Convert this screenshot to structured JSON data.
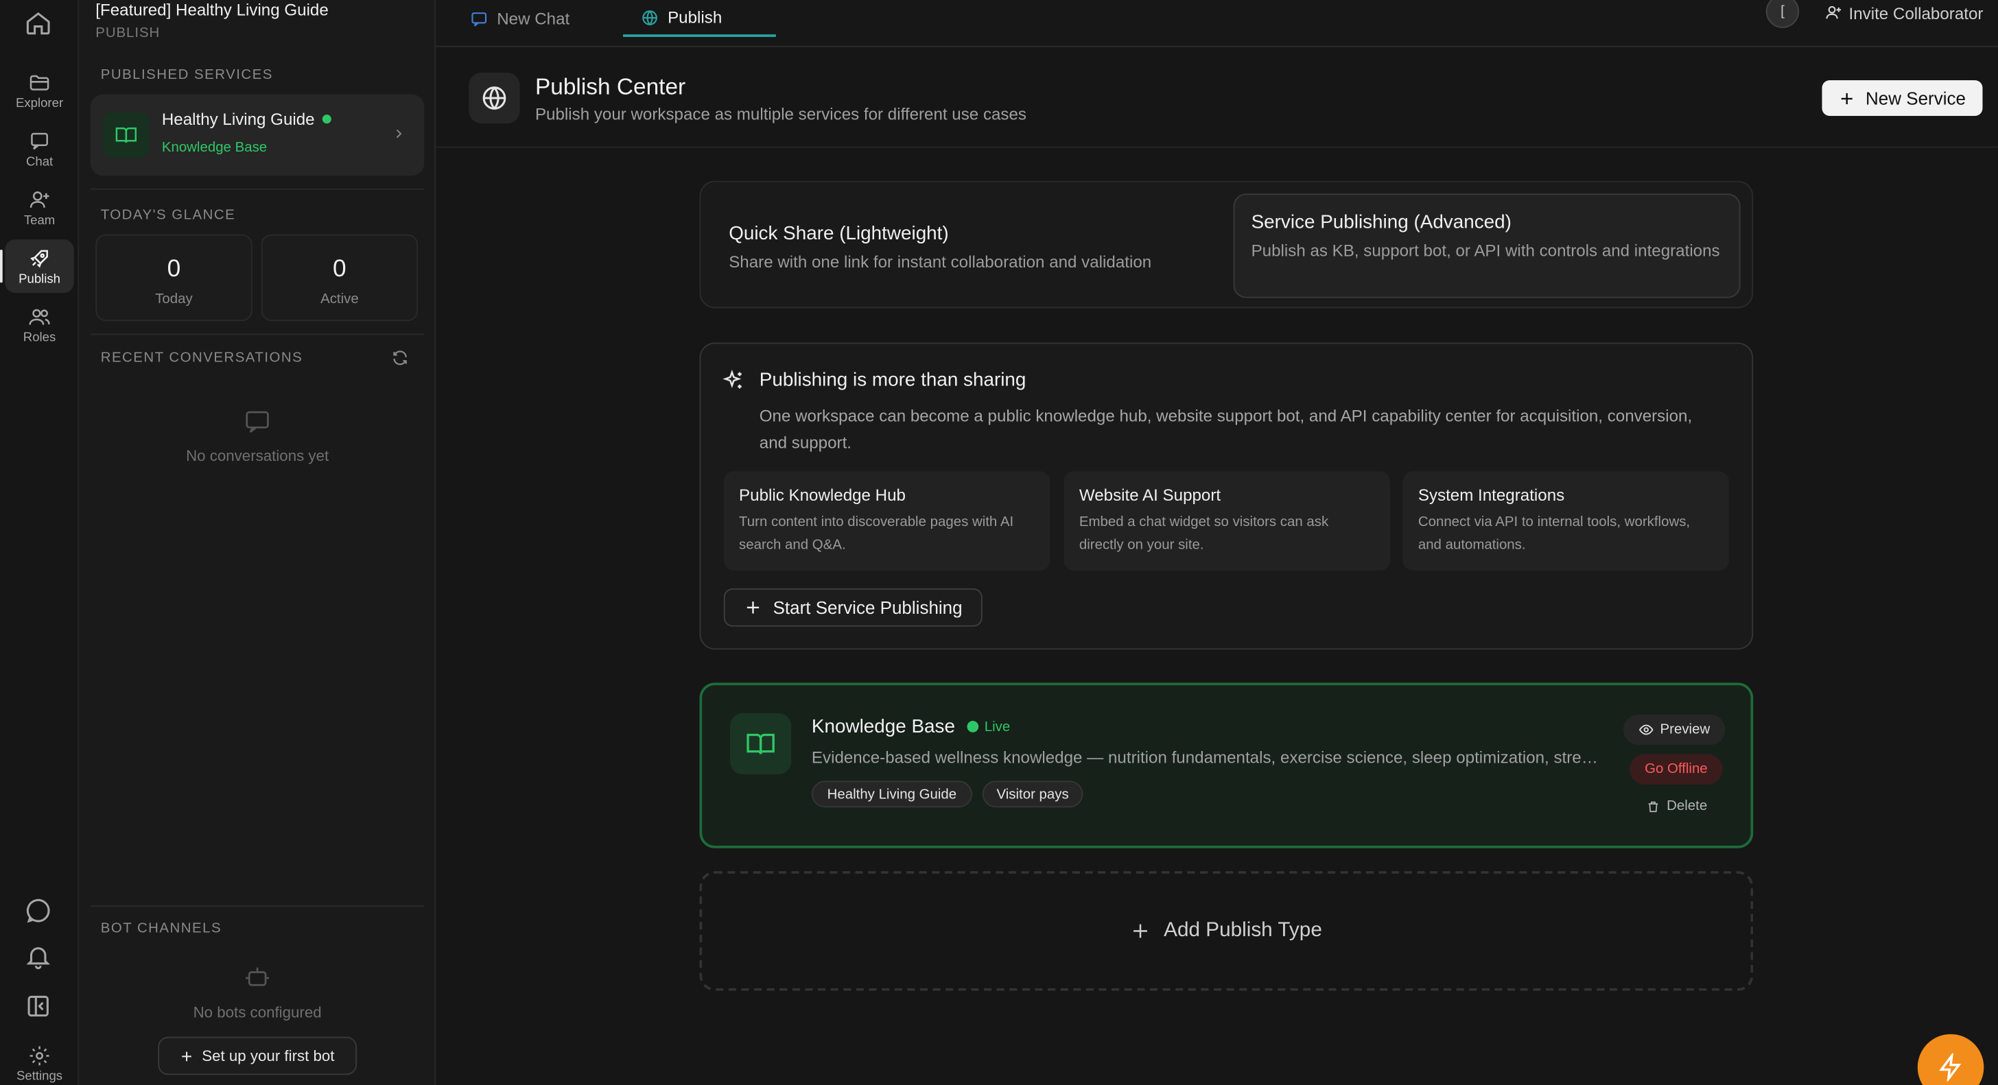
{
  "rail": {
    "items": [
      {
        "label": "Explorer"
      },
      {
        "label": "Chat"
      },
      {
        "label": "Team"
      },
      {
        "label": "Publish"
      },
      {
        "label": "Roles"
      },
      {
        "label": "Settings"
      }
    ]
  },
  "sidebar": {
    "workspace_title": "[Featured] Healthy Living Guide",
    "workspace_subtitle": "PUBLISH",
    "published_label": "PUBLISHED SERVICES",
    "service": {
      "name": "Healthy Living Guide",
      "type": "Knowledge Base",
      "status_color": "#2fc766"
    },
    "glance_label": "TODAY'S GLANCE",
    "glance": [
      {
        "value": "0",
        "label": "Today"
      },
      {
        "value": "0",
        "label": "Active"
      }
    ],
    "recent_label": "RECENT CONVERSATIONS",
    "recent_empty": "No conversations yet",
    "bots_label": "BOT CHANNELS",
    "bots_empty": "No bots configured",
    "bots_button": "Set up your first bot"
  },
  "topbar": {
    "tabs": [
      {
        "label": "New Chat"
      },
      {
        "label": "Publish"
      }
    ],
    "avatar_letter": "[",
    "invite_label": "Invite Collaborator"
  },
  "header": {
    "title": "Publish Center",
    "subtitle": "Publish your workspace as multiple services for different use cases",
    "new_service": "New Service"
  },
  "modes": {
    "quick": {
      "title": "Quick Share (Lightweight)",
      "desc": "Share with one link for instant collaboration and validation"
    },
    "advanced": {
      "title": "Service Publishing (Advanced)",
      "desc": "Publish as KB, support bot, or API with controls and integrations"
    }
  },
  "info": {
    "title": "Publishing is more than sharing",
    "desc": "One workspace can become a public knowledge hub, website support bot, and API capability center for acquisition, conversion, and support.",
    "features": [
      {
        "title": "Public Knowledge Hub",
        "desc": "Turn content into discoverable pages with AI search and Q&A."
      },
      {
        "title": "Website AI Support",
        "desc": "Embed a chat widget so visitors can ask directly on your site."
      },
      {
        "title": "System Integrations",
        "desc": "Connect via API to internal tools, workflows, and automations."
      }
    ],
    "start_button": "Start Service Publishing"
  },
  "kb": {
    "title": "Knowledge Base",
    "status": "Live",
    "desc": "Evidence-based wellness knowledge — nutrition fundamentals, exercise science, sleep optimization, stress management and more",
    "chips": [
      "Healthy Living Guide",
      "Visitor pays"
    ],
    "preview": "Preview",
    "offline": "Go Offline",
    "delete": "Delete"
  },
  "add_type": "Add Publish Type",
  "colors": {
    "accent_green": "#2fc766",
    "tab_underline": "#2aa3a0",
    "danger": "#ff5a5a",
    "fab": "#f28c1b"
  }
}
